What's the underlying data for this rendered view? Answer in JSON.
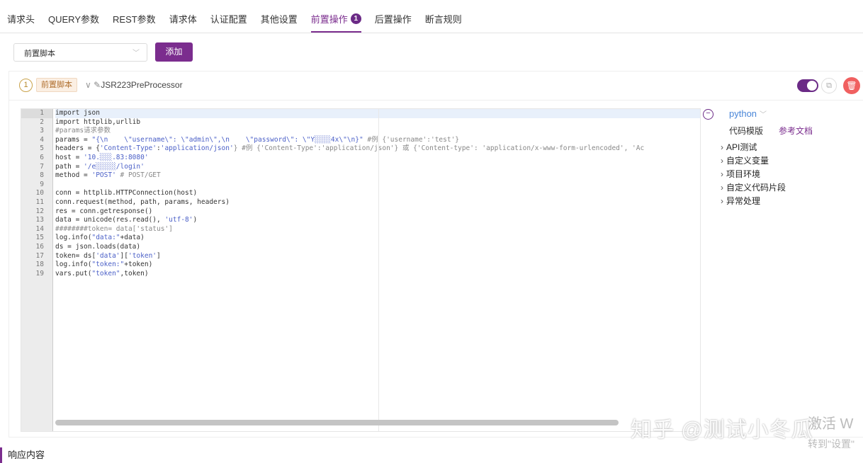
{
  "tabs": [
    {
      "label": "请求头"
    },
    {
      "label": "QUERY参数"
    },
    {
      "label": "REST参数"
    },
    {
      "label": "请求体"
    },
    {
      "label": "认证配置"
    },
    {
      "label": "其他设置"
    },
    {
      "label": "前置操作",
      "badge": "1",
      "active": true
    },
    {
      "label": "后置操作"
    },
    {
      "label": "断言规则"
    }
  ],
  "toolbar": {
    "select_value": "前置脚本",
    "add_label": "添加"
  },
  "processor": {
    "index": "1",
    "tag": "前置脚本",
    "name": "JSR223PreProcessor",
    "enabled": true
  },
  "editor": {
    "lines": [
      [
        [
          "import json",
          ""
        ]
      ],
      [
        [
          "import httplib,urllib",
          ""
        ]
      ],
      [
        [
          "#params请求参数",
          "c"
        ]
      ],
      [
        [
          "params = ",
          ""
        ],
        [
          "\"{\\n    \\\"username\\\": \\\"admin\\\",\\n    \\\"password\\\": \\\"Y░░░░4x\\\"\\n}\"",
          "s"
        ],
        [
          " #例 {'username':'test'}",
          "c"
        ]
      ],
      [
        [
          "headers = {",
          ""
        ],
        [
          "'Content-Type'",
          "s"
        ],
        [
          ":",
          ""
        ],
        [
          "'application/json'",
          "s"
        ],
        [
          "} #例 {'Content-Type':'application/json'} 或 {'Content-type': 'application/x-www-form-urlencoded', 'Ac",
          "c"
        ]
      ],
      [
        [
          "host = ",
          ""
        ],
        [
          "'10.░░░.83:8080'",
          "s"
        ]
      ],
      [
        [
          "path = ",
          ""
        ],
        [
          "'/e░░░░░/login'",
          "s"
        ]
      ],
      [
        [
          "method = ",
          ""
        ],
        [
          "'POST'",
          "s"
        ],
        [
          " # POST/GET",
          "c"
        ]
      ],
      [
        [
          "",
          ""
        ]
      ],
      [
        [
          "conn = httplib.HTTPConnection(host)",
          ""
        ]
      ],
      [
        [
          "conn.request(method, path, params, headers)",
          ""
        ]
      ],
      [
        [
          "res = conn.getresponse()",
          ""
        ]
      ],
      [
        [
          "data = unicode(res.read(), ",
          ""
        ],
        [
          "'utf-8'",
          "s"
        ],
        [
          ")",
          ""
        ]
      ],
      [
        [
          "########token= data['status']",
          "c"
        ]
      ],
      [
        [
          "log.info(",
          ""
        ],
        [
          "\"data:\"",
          "s"
        ],
        [
          "+data)",
          ""
        ]
      ],
      [
        [
          "ds = json.loads(data)",
          ""
        ]
      ],
      [
        [
          "token= ds[",
          ""
        ],
        [
          "'data'",
          "s"
        ],
        [
          "][",
          ""
        ],
        [
          "'token'",
          "s"
        ],
        [
          "]",
          ""
        ]
      ],
      [
        [
          "log.info(",
          ""
        ],
        [
          "\"token:\"",
          "s"
        ],
        [
          "+token)",
          ""
        ]
      ],
      [
        [
          "vars.put(",
          ""
        ],
        [
          "\"token\"",
          "s"
        ],
        [
          ",token)",
          ""
        ]
      ]
    ]
  },
  "side": {
    "language": "python",
    "template_label": "代码模版",
    "docs_label": "参考文档",
    "items": [
      {
        "label": "API测试"
      },
      {
        "label": "自定义变量"
      },
      {
        "label": "项目环境"
      },
      {
        "label": "自定义代码片段"
      },
      {
        "label": "异常处理"
      }
    ]
  },
  "response_label": "响应内容",
  "watermark": "知乎 @测试小冬瓜",
  "activation": {
    "line1": "激活 W",
    "line2": "转到\"设置\""
  }
}
